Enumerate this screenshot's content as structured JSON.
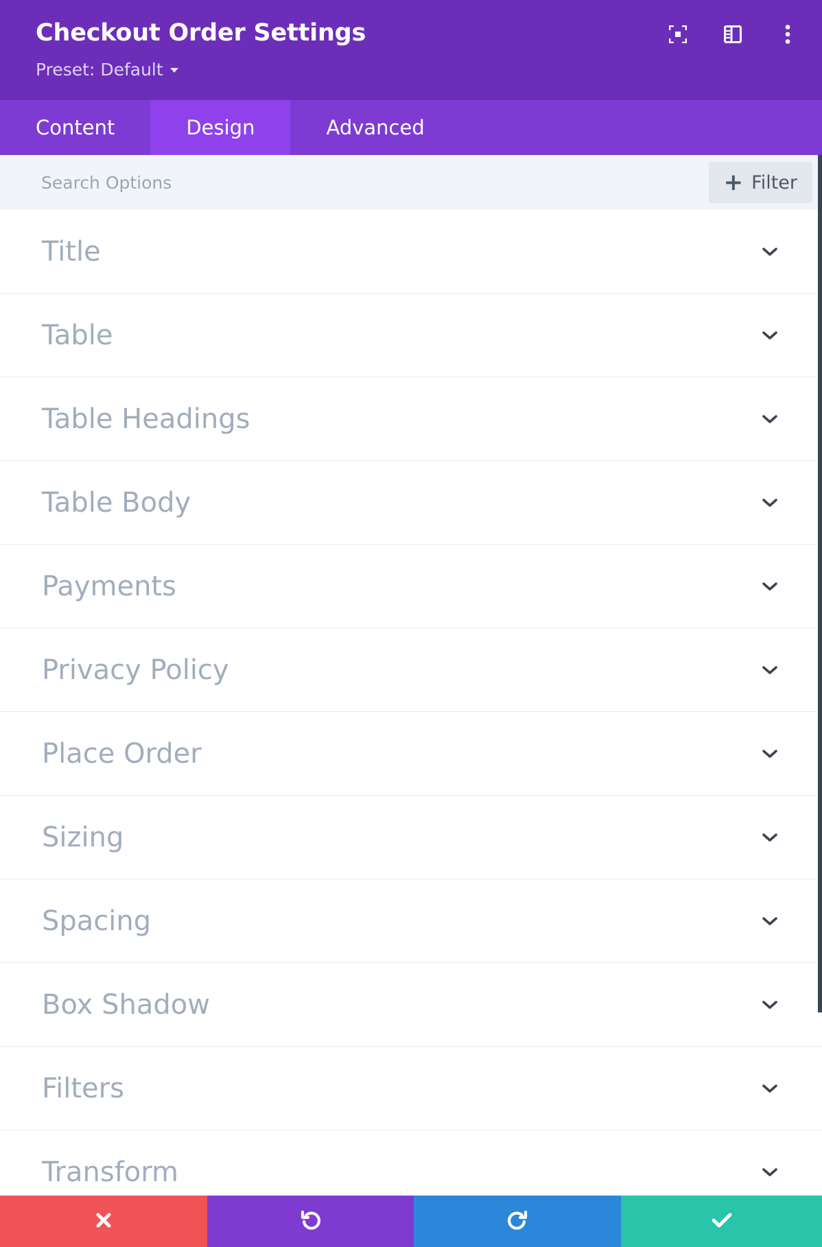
{
  "header": {
    "title": "Checkout Order Settings",
    "preset_label": "Preset: Default",
    "icons": [
      "fullscreen-icon",
      "sidebar-layout-icon",
      "more-vertical-icon"
    ]
  },
  "tabs": [
    {
      "label": "Content",
      "active": false
    },
    {
      "label": "Design",
      "active": true
    },
    {
      "label": "Advanced",
      "active": false
    }
  ],
  "search": {
    "placeholder": "Search Options",
    "value": "",
    "filter_label": "Filter"
  },
  "sections": [
    {
      "label": "Title"
    },
    {
      "label": "Table"
    },
    {
      "label": "Table Headings"
    },
    {
      "label": "Table Body"
    },
    {
      "label": "Payments"
    },
    {
      "label": "Privacy Policy"
    },
    {
      "label": "Place Order"
    },
    {
      "label": "Sizing"
    },
    {
      "label": "Spacing"
    },
    {
      "label": "Box Shadow"
    },
    {
      "label": "Filters"
    },
    {
      "label": "Transform"
    }
  ],
  "actions": [
    {
      "name": "discard",
      "icon": "close-icon",
      "color": "#ef5355"
    },
    {
      "name": "undo",
      "icon": "undo-icon",
      "color": "#7e3bd0"
    },
    {
      "name": "redo",
      "icon": "redo-icon",
      "color": "#2b87da"
    },
    {
      "name": "save",
      "icon": "check-icon",
      "color": "#29c4a9"
    }
  ],
  "colors": {
    "header_bg": "#6c2eb9",
    "tabs_bg": "#7d3bd3",
    "active_tab_bg": "#8f42ec",
    "search_bg": "#f1f5f9",
    "label_color": "#a1adbd"
  }
}
